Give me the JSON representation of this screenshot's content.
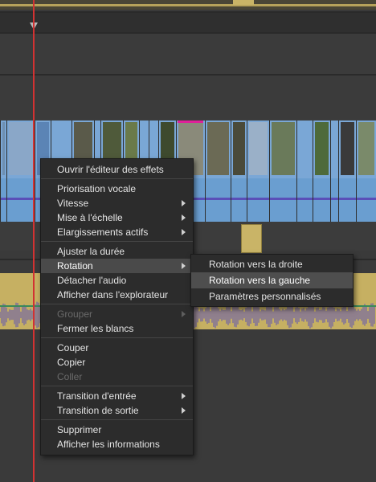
{
  "context_menu": {
    "items": [
      {
        "label": "Ouvrir l'éditeur des effets",
        "submenu": false,
        "disabled": false
      },
      {
        "sep": true
      },
      {
        "label": "Priorisation vocale",
        "submenu": false,
        "disabled": false
      },
      {
        "label": "Vitesse",
        "submenu": true,
        "disabled": false
      },
      {
        "label": "Mise à l'échelle",
        "submenu": true,
        "disabled": false
      },
      {
        "label": "Elargissements actifs",
        "submenu": true,
        "disabled": false
      },
      {
        "sep": true
      },
      {
        "label": "Ajuster la durée",
        "submenu": false,
        "disabled": false
      },
      {
        "label": "Rotation",
        "submenu": true,
        "disabled": false,
        "active": true
      },
      {
        "label": "Détacher l'audio",
        "submenu": false,
        "disabled": false
      },
      {
        "label": "Afficher dans l'explorateur",
        "submenu": false,
        "disabled": false
      },
      {
        "sep": true
      },
      {
        "label": "Grouper",
        "submenu": true,
        "disabled": true
      },
      {
        "label": "Fermer les blancs",
        "submenu": false,
        "disabled": false
      },
      {
        "sep": true
      },
      {
        "label": "Couper",
        "submenu": false,
        "disabled": false
      },
      {
        "label": "Copier",
        "submenu": false,
        "disabled": false
      },
      {
        "label": "Coller",
        "submenu": false,
        "disabled": true
      },
      {
        "sep": true
      },
      {
        "label": "Transition d'entrée",
        "submenu": true,
        "disabled": false
      },
      {
        "label": "Transition de sortie",
        "submenu": true,
        "disabled": false
      },
      {
        "sep": true
      },
      {
        "label": "Supprimer",
        "submenu": false,
        "disabled": false
      },
      {
        "label": "Afficher les informations",
        "submenu": false,
        "disabled": false
      }
    ]
  },
  "rotation_submenu": {
    "items": [
      {
        "label": "Rotation vers la droite",
        "active": false
      },
      {
        "label": "Rotation vers la gauche",
        "active": true
      },
      {
        "label": "Paramètres personnalisés",
        "active": false
      }
    ]
  },
  "colors": {
    "background": "#3a3a3a",
    "playhead": "#d23232",
    "clip_frame": "#7aa7d6",
    "audio_wave": "#5a4fb8",
    "audio_track": "#c9b467",
    "selection_marker": "#e0209a",
    "menu_bg": "#2c2c2c",
    "menu_text": "#e4e4e4"
  }
}
